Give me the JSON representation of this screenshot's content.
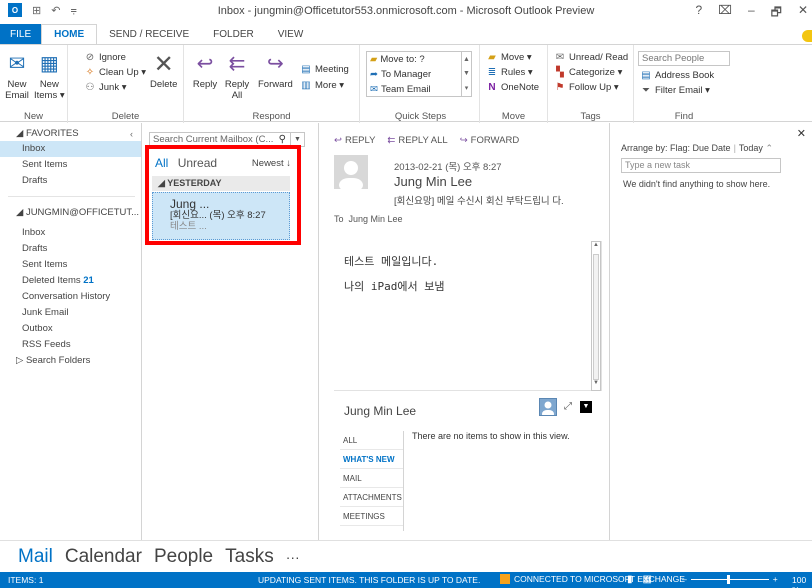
{
  "titlebar": {
    "title": "Inbox - jungmin@Officetutor553.onmicrosoft.com - Microsoft Outlook Preview",
    "app_icon": "O",
    "buttons": [
      "?",
      "⌧",
      "–",
      "🗗",
      "✕"
    ]
  },
  "tabs": [
    "FILE",
    "HOME",
    "SEND / RECEIVE",
    "FOLDER",
    "VIEW"
  ],
  "ribbon": {
    "new": {
      "new_email": "New\nEmail",
      "new_items": "New\nItems ▾",
      "label": "New"
    },
    "delete": {
      "ignore": "Ignore",
      "cleanup": "Clean Up ▾",
      "junk": "Junk ▾",
      "delete": "Delete",
      "label": "Delete"
    },
    "respond": {
      "reply": "Reply",
      "reply_all": "Reply\nAll",
      "forward": "Forward",
      "meeting": "Meeting",
      "more": "More ▾",
      "label": "Respond"
    },
    "quick_steps": {
      "items": [
        "Move to: ?",
        "To Manager",
        "Team Email"
      ],
      "label": "Quick Steps"
    },
    "move": {
      "move": "Move ▾",
      "rules": "Rules ▾",
      "onenote": "OneNote",
      "label": "Move"
    },
    "tags": {
      "unread_read": "Unread/ Read",
      "categorize": "Categorize ▾",
      "follow_up": "Follow Up ▾",
      "label": "Tags"
    },
    "find": {
      "search_people": "Search People",
      "address_book": "Address Book",
      "filter_email": "Filter Email ▾",
      "label": "Find"
    }
  },
  "folders": {
    "favorites_header": "◢ FAVORITES",
    "favorites": [
      "Inbox",
      "Sent Items",
      "Drafts"
    ],
    "account_header": "◢ JUNGMIN@OFFICETUT...",
    "account": [
      {
        "label": "Inbox"
      },
      {
        "label": "Drafts"
      },
      {
        "label": "Sent Items"
      },
      {
        "label": "Deleted Items",
        "count": "21"
      },
      {
        "label": "Conversation History"
      },
      {
        "label": "Junk Email"
      },
      {
        "label": "Outbox"
      },
      {
        "label": "RSS Feeds"
      },
      {
        "label": "▷ Search Folders"
      }
    ]
  },
  "message_list": {
    "search_placeholder": "Search Current Mailbox (C...",
    "filter_all": "All",
    "filter_unread": "Unread",
    "sort": "Newest ↓",
    "group": "◢ YESTERDAY",
    "item": {
      "sender": "Jung ...",
      "subject": "[회신요... (목) 오후 8:27",
      "preview": "테스트 ..."
    }
  },
  "reading": {
    "actions": [
      "REPLY",
      "REPLY ALL",
      "FORWARD"
    ],
    "date": "2013-02-21 (목) 오후 8:27",
    "from": "Jung Min Lee",
    "subject": "[회신요망] 메일 수신시 회신 부탁드립니 다.",
    "to_label": "To",
    "to": "Jung Min Lee",
    "body_line1": "테스트 메일입니다.",
    "body_line2": "나의 iPad에서 보냄"
  },
  "people_pane": {
    "name": "Jung Min Lee",
    "tabs": [
      "ALL",
      "WHAT'S NEW",
      "MAIL",
      "ATTACHMENTS",
      "MEETINGS"
    ],
    "empty": "There are no items to show in this view."
  },
  "todo": {
    "arrange": "Arrange by: Flag: Due Date",
    "today": "Today",
    "task_placeholder": "Type a new task",
    "empty": "We didn't find anything to show here."
  },
  "nav": [
    "Mail",
    "Calendar",
    "People",
    "Tasks",
    "···"
  ],
  "status": {
    "items": "ITEMS: 1",
    "updating": "UPDATING SENT ITEMS.  THIS FOLDER IS UP TO DATE.",
    "connected": "CONNECTED TO MICROSOFT EXCHANGE",
    "zoom": "100 %"
  },
  "colors": {
    "accent": "#0072c6",
    "selection": "#cde6f7",
    "highlight_box": "#ff0000"
  }
}
